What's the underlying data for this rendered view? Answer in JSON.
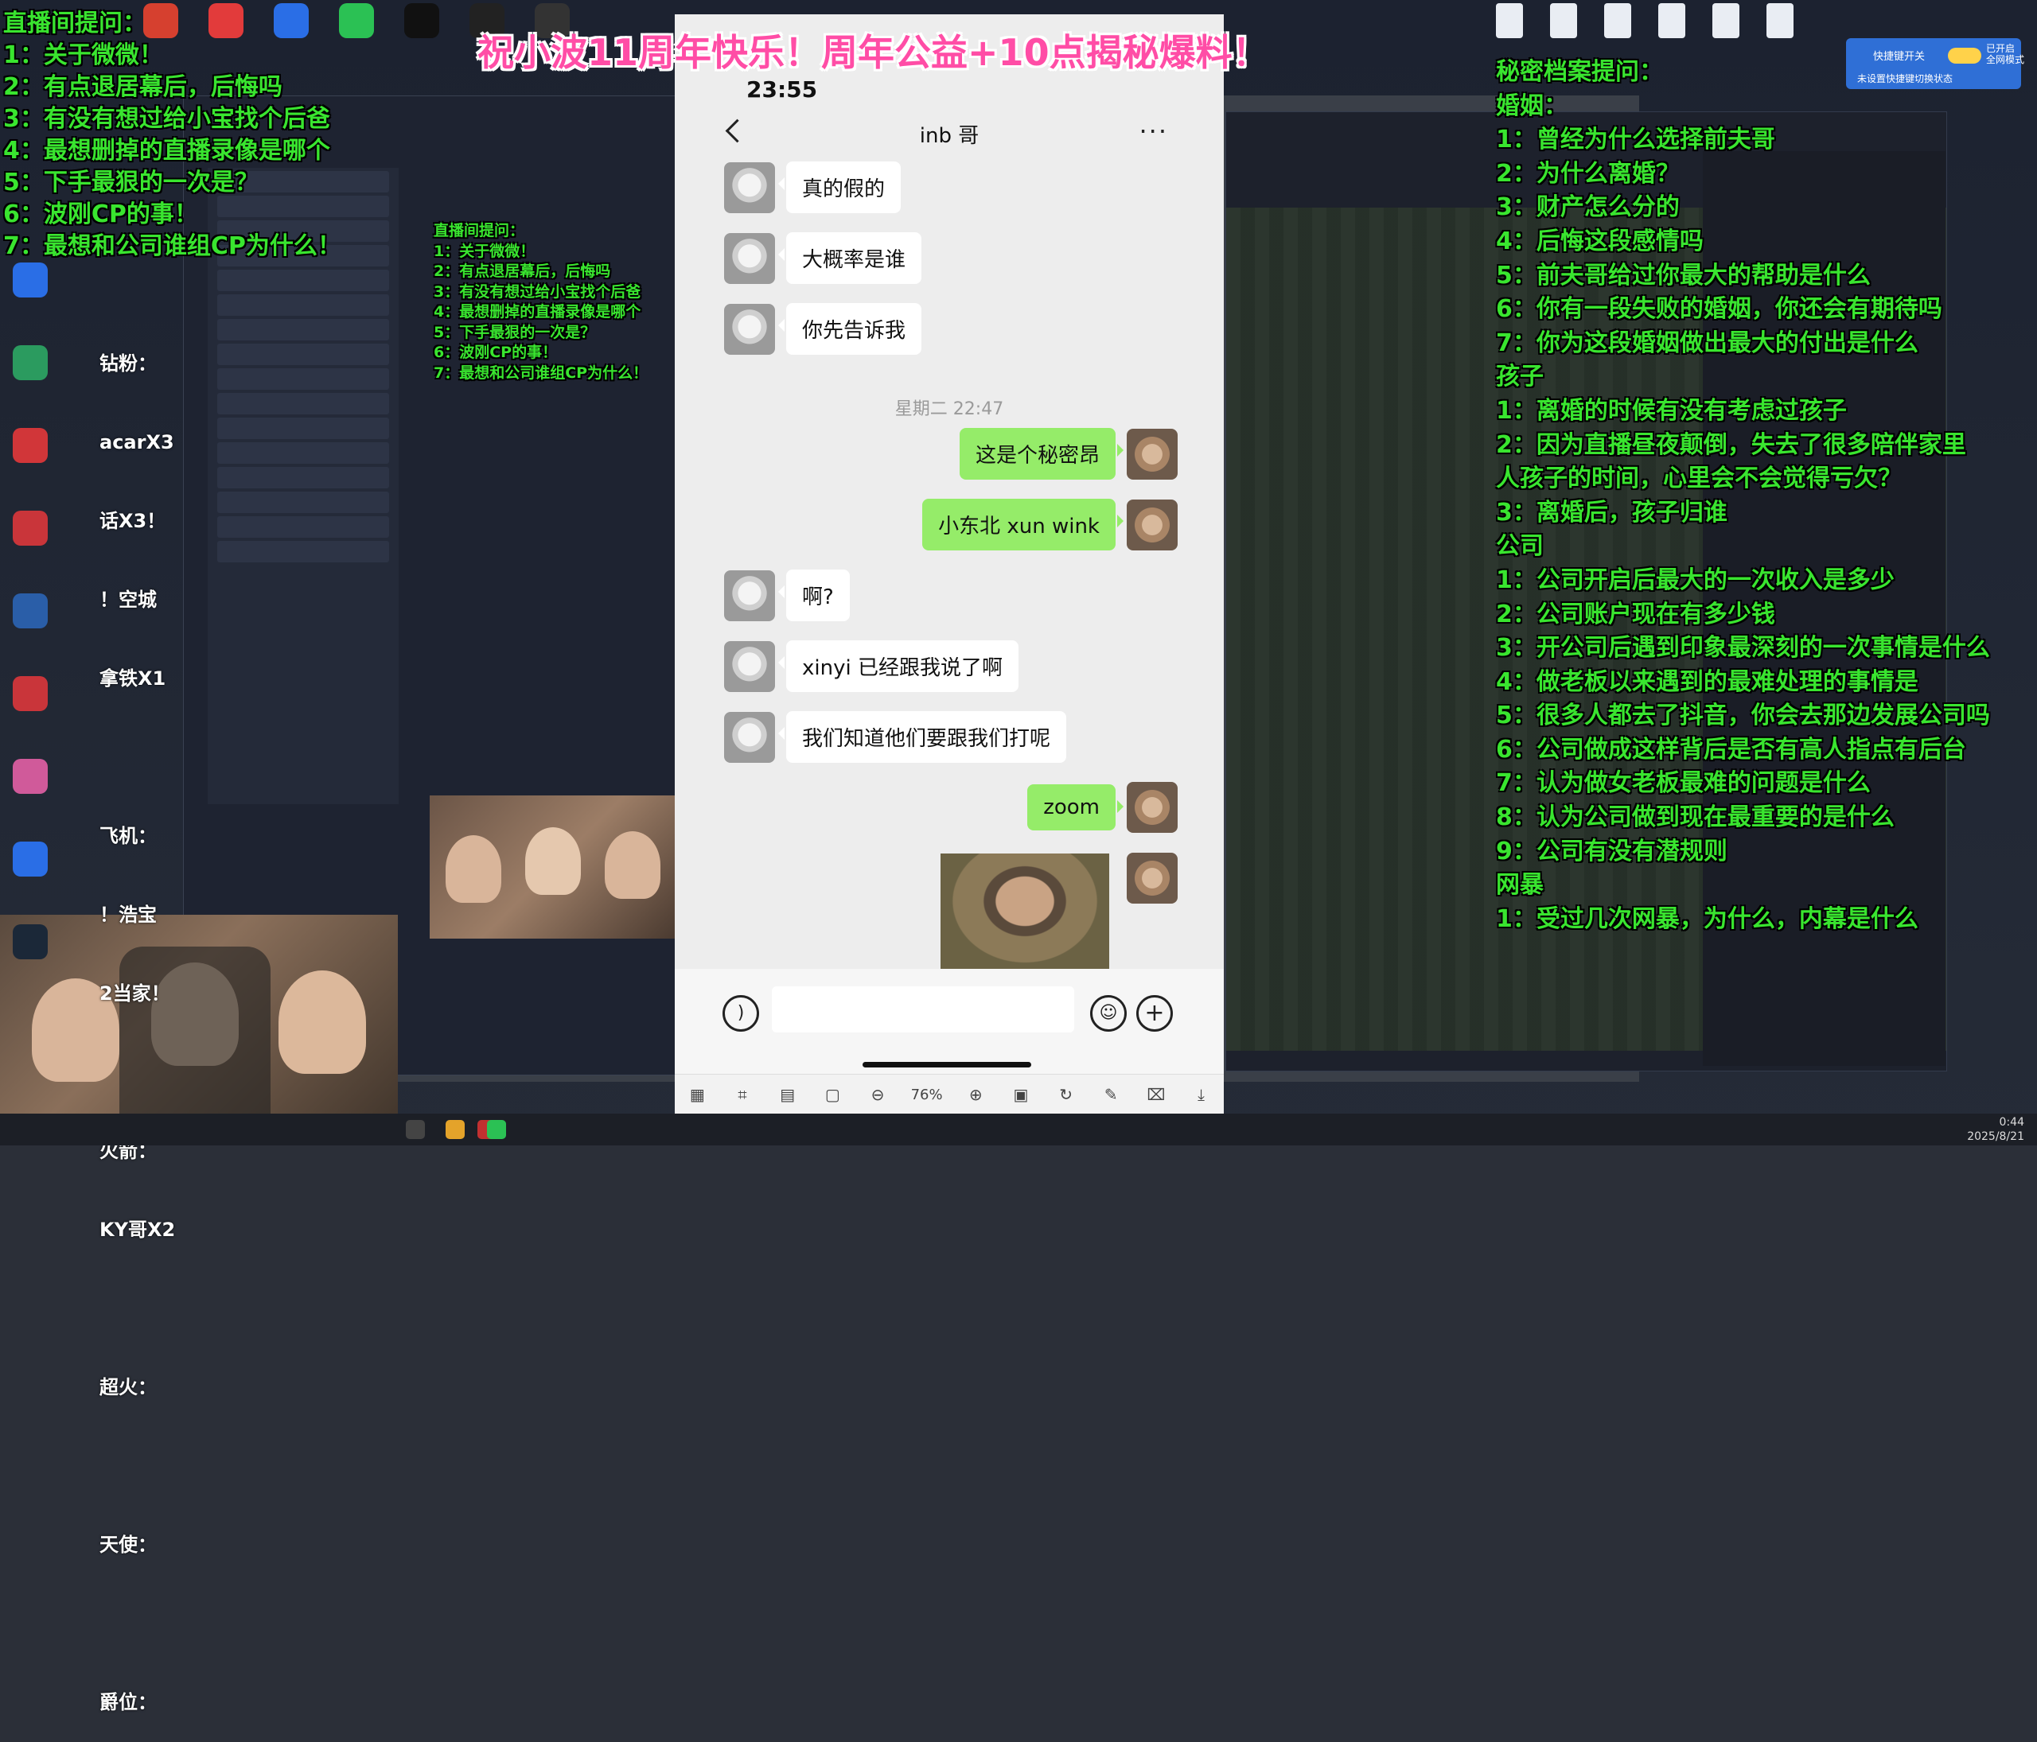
{
  "top_banner": "祝小波11周年快乐！周年公益+10点揭秘爆料！",
  "left_overlay": [
    "直播间提问：",
    "1：关于微微！",
    "2：有点退居幕后，后悔吗",
    "3：有没有想过给小宝找个后爸",
    "4：最想删掉的直播录像是哪个",
    "5：下手最狠的一次是？",
    "6：波刚CP的事！",
    "7：最想和公司谁组CP为什么！"
  ],
  "right_overlay": [
    "秘密档案提问：",
    "婚姻：",
    "1：曾经为什么选择前夫哥",
    "2：为什么离婚？",
    "3：财产怎么分的",
    "4：后悔这段感情吗",
    "5：前夫哥给过你最大的帮助是什么",
    "6：你有一段失败的婚姻，你还会有期待吗",
    "7：你为这段婚姻做出最大的付出是什么",
    "孩子",
    "1：离婚的时候有没有考虑过孩子",
    "2：因为直播昼夜颠倒，失去了很多陪伴家里",
    "人孩子的时间，心里会不会觉得亏欠？",
    "3：离婚后，孩子归谁",
    "公司",
    "1：公司开启后最大的一次收入是多少",
    "2：公司账户现在有多少钱",
    "3：开公司后遇到印象最深刻的一次事情是什么",
    "4：做老板以来遇到的最难处理的事情是",
    "5：很多人都去了抖音，你会去那边发展公司吗",
    "6：公司做成这样背后是否有高人指点有后台",
    "7：认为做女老板最难的问题是什么",
    "8：认为公司做到现在最重要的是什么",
    "9：公司有没有潜规则",
    "网暴",
    "1：受过几次网暴，为什么，内幕是什么"
  ],
  "white_list": [
    "钻粉：",
    "acarX3",
    "话X3！",
    "！空城",
    "拿铁X1",
    "",
    "飞机：",
    "！浩宝",
    "2当家！",
    "",
    "火箭：",
    "KY哥X2",
    "",
    "超火：",
    "",
    "天使：",
    "",
    "爵位："
  ],
  "phone": {
    "status_time": "23:55",
    "chat_title": "inb 哥",
    "more_label": "···",
    "timestamp": "星期二 22:47",
    "messages": [
      {
        "side": "in",
        "text": "真的假的"
      },
      {
        "side": "in",
        "text": "大概率是谁"
      },
      {
        "side": "in",
        "text": "你先告诉我"
      },
      {
        "side": "out",
        "text": "这是个秘密昂"
      },
      {
        "side": "out",
        "text": "小东北 xun wink"
      },
      {
        "side": "in",
        "text": "啊?"
      },
      {
        "side": "in",
        "text": "xinyi 已经跟我说了啊"
      },
      {
        "side": "in",
        "text": "我们知道他们要跟我们打呢"
      },
      {
        "side": "out",
        "text": "zoom"
      }
    ]
  },
  "viewer_toolbar": {
    "zoom": "76%"
  },
  "widget": {
    "title": "快捷键开关",
    "state": "已开启\n全网模式",
    "sub": "未设置快捷键切换状态"
  },
  "taskbar": {
    "time": "0:44",
    "date": "2025/8/21"
  },
  "colors": {
    "overlay_green": "#39e52f",
    "banner_pink": "#ff4da6",
    "bubble_green": "#95ec69"
  }
}
